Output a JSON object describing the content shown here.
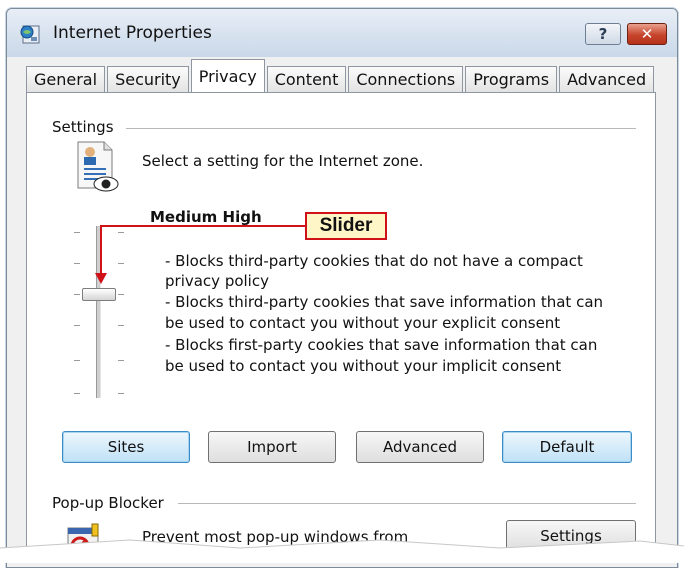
{
  "window": {
    "title": "Internet Properties",
    "help_label": "?",
    "close_label": "✕"
  },
  "tabs": [
    {
      "label": "General"
    },
    {
      "label": "Security"
    },
    {
      "label": "Privacy",
      "active": true
    },
    {
      "label": "Content"
    },
    {
      "label": "Connections"
    },
    {
      "label": "Programs"
    },
    {
      "label": "Advanced"
    }
  ],
  "settings": {
    "group_label": "Settings",
    "intro": "Select a setting for the Internet zone.",
    "level": "Medium High",
    "slider_level": 4,
    "slider_positions": 6,
    "description": [
      "- Blocks third-party cookies that do not have a compact",
      "privacy policy",
      "- Blocks third-party cookies that save information that can",
      "be used to contact you without your explicit consent",
      "- Blocks first-party cookies that save information that can",
      "be used to contact you without your implicit consent"
    ],
    "buttons": {
      "sites": "Sites",
      "import": "Import",
      "advanced": "Advanced",
      "default": "Default"
    }
  },
  "callout": {
    "label": "Slider"
  },
  "popup_blocker": {
    "group_label": "Pop-up Blocker",
    "text": "Prevent most pop-up windows from",
    "settings_button": "Settings"
  },
  "colors": {
    "callout_border": "#d01218",
    "callout_fill": "#fff6c7",
    "focus_button": "#bfe1f6"
  }
}
